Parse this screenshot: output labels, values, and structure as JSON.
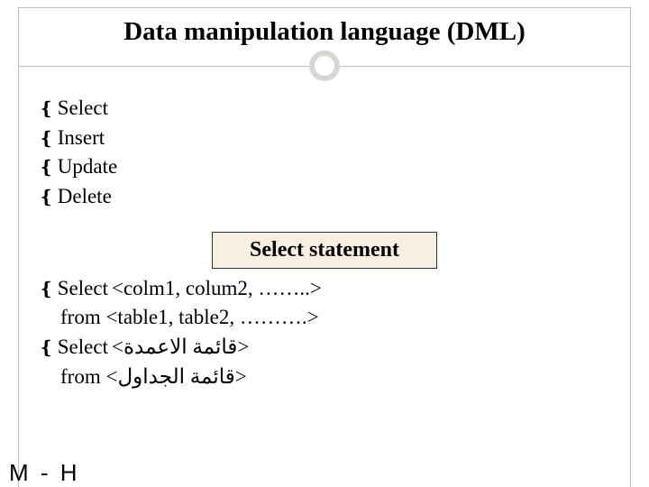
{
  "title": "Data manipulation language (DML)",
  "bullets": {
    "b1": "Select",
    "b2": "Insert",
    "b3": "Update",
    "b4": "Delete"
  },
  "box_label": "Select  statement",
  "stmt": {
    "line1_kw": "Select ",
    "line1_rest": "<colm1, colum2, ……..>",
    "line2": "from <table1, table2, ……….>",
    "line3_kw": "Select ",
    "line3_rest": "<قائمة     الاعمدة>",
    "line4_prefix": "from ",
    "line4_rtl": "<قائمة الجداول>"
  },
  "footer": "M - H",
  "bullet_glyph": "❴"
}
